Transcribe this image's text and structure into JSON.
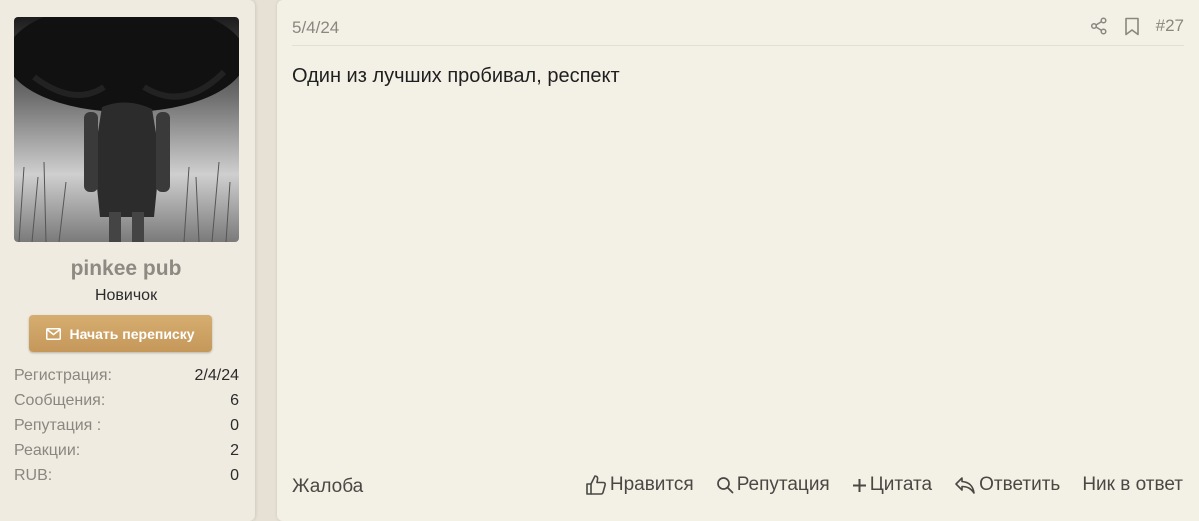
{
  "user": {
    "name": "pinkee pub",
    "title": "Новичок",
    "start_conversation_label": "Начать переписку",
    "stats": [
      {
        "label": "Регистрация:",
        "value": "2/4/24"
      },
      {
        "label": "Сообщения:",
        "value": "6"
      },
      {
        "label": "Репутация :",
        "value": "0"
      },
      {
        "label": "Реакции:",
        "value": "2"
      },
      {
        "label": "RUB:",
        "value": "0"
      }
    ]
  },
  "post": {
    "date": "5/4/24",
    "number": "#27",
    "body": "Один из лучших пробивал, респект",
    "report_label": "Жалоба",
    "actions": {
      "like": "Нравится",
      "reputation": "Репутация",
      "quote": "Цитата",
      "reply": "Ответить",
      "nick_reply": "Ник в ответ"
    }
  },
  "colors": {
    "accent": "#c9a064",
    "muted_text": "#8b8780",
    "panel_bg": "#f3f0e6",
    "sidebar_bg": "#efebe1"
  },
  "icons": {
    "envelope": "envelope-icon",
    "share": "share-icon",
    "bookmark": "bookmark-icon",
    "like": "thumbs-up-icon",
    "reputation": "search-icon",
    "quote": "plus-icon",
    "reply": "reply-icon"
  }
}
